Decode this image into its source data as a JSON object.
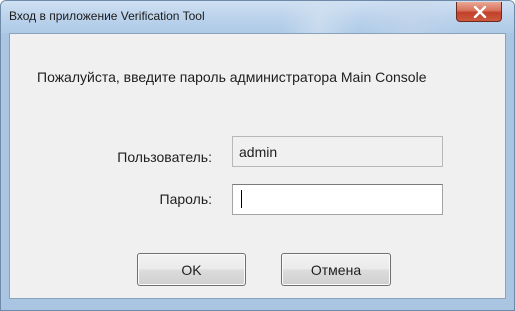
{
  "window": {
    "title": "Вход в приложение Verification Tool",
    "close_icon": "close-x-icon"
  },
  "dialog": {
    "message": "Пожалуйста, введите пароль администратора Main Console",
    "user_label": "Пользователь:",
    "user_value": "admin",
    "password_label": "Пароль:",
    "password_value": ""
  },
  "buttons": {
    "ok_label": "OK",
    "cancel_label": "Отмена"
  },
  "colors": {
    "titlebar": "#b9d1ea",
    "close_button": "#c7432d",
    "client_background": "#f0f0f0"
  }
}
